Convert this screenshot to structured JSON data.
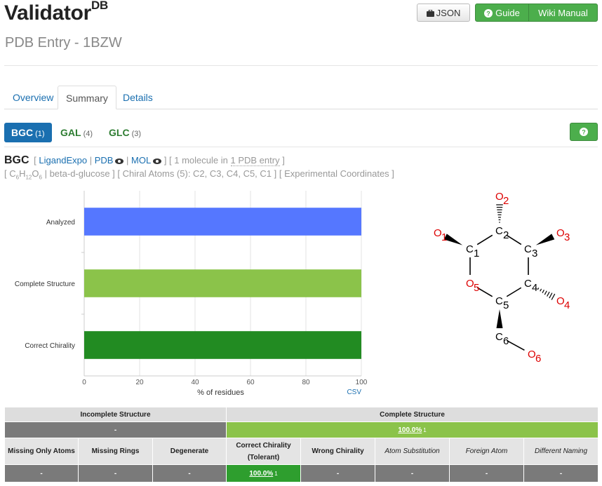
{
  "header": {
    "title": "Validator",
    "title_sup": "DB",
    "subtitle": "PDB Entry - 1BZW",
    "json_button": "JSON",
    "guide_button": "Guide",
    "wiki_button": "Wiki Manual"
  },
  "tabs": [
    {
      "label": "Overview",
      "active": false
    },
    {
      "label": "Summary",
      "active": true
    },
    {
      "label": "Details",
      "active": false
    }
  ],
  "ligand_pills": [
    {
      "code": "BGC",
      "count": "(1)",
      "active": true
    },
    {
      "code": "GAL",
      "count": "(4)",
      "active": false
    },
    {
      "code": "GLC",
      "count": "(3)",
      "active": false
    }
  ],
  "ligand": {
    "code": "BGC",
    "link_ligandexpo": "LigandExpo",
    "link_pdb": "PDB",
    "link_mol": "MOL",
    "molecule_count": "1 molecule in",
    "pdb_entry_link": "1 PDB entry",
    "formula_c": "C",
    "formula_c_n": "6",
    "formula_h": "H",
    "formula_h_n": "12",
    "formula_o": "O",
    "formula_o_n": "6",
    "name": "beta-d-glucose",
    "chiral_atoms": "Chiral Atoms (5): C2, C3, C4, C5, C1",
    "coordinates": "Experimental Coordinates"
  },
  "chart_data": {
    "type": "bar",
    "orientation": "horizontal",
    "categories": [
      "Analyzed",
      "Complete Structure",
      "Correct Chirality"
    ],
    "values": [
      100,
      100,
      100
    ],
    "colors": [
      "#5577ff",
      "#8bc34a",
      "#228b22"
    ],
    "xlabel": "% of residues",
    "xlim": [
      0,
      100
    ],
    "xticks": [
      0,
      20,
      40,
      60,
      80,
      100
    ],
    "csv_link": "CSV"
  },
  "molecule": {
    "atoms": [
      {
        "id": "O1",
        "el": "O",
        "n": "1"
      },
      {
        "id": "C1",
        "el": "C",
        "n": "1"
      },
      {
        "id": "C2",
        "el": "C",
        "n": "2"
      },
      {
        "id": "O2",
        "el": "O",
        "n": "2"
      },
      {
        "id": "C3",
        "el": "C",
        "n": "3"
      },
      {
        "id": "O3",
        "el": "O",
        "n": "3"
      },
      {
        "id": "C4",
        "el": "C",
        "n": "4"
      },
      {
        "id": "O4",
        "el": "O",
        "n": "4"
      },
      {
        "id": "C5",
        "el": "C",
        "n": "5"
      },
      {
        "id": "O5",
        "el": "O",
        "n": "5"
      },
      {
        "id": "C6",
        "el": "C",
        "n": "6"
      },
      {
        "id": "O6",
        "el": "O",
        "n": "6"
      }
    ],
    "oxygen_color": "#dd0000"
  },
  "summary_table": {
    "incomplete_header": "Incomplete Structure",
    "complete_header": "Complete Structure",
    "incomplete_value": "-",
    "complete_value": "100.0%",
    "complete_count": "1",
    "categories": [
      {
        "label": "Missing Only Atoms",
        "value": "-",
        "italic": false
      },
      {
        "label": "Missing Rings",
        "value": "-",
        "italic": false
      },
      {
        "label": "Degenerate",
        "value": "-",
        "italic": false
      },
      {
        "label": "Correct Chirality (Tolerant)",
        "value": "100.0%",
        "count": "1",
        "italic": false
      },
      {
        "label": "Wrong Chirality",
        "value": "-",
        "italic": false
      },
      {
        "label": "Atom Substitution",
        "value": "-",
        "italic": true
      },
      {
        "label": "Foreign Atom",
        "value": "-",
        "italic": true
      },
      {
        "label": "Different Naming",
        "value": "-",
        "italic": true
      }
    ]
  }
}
